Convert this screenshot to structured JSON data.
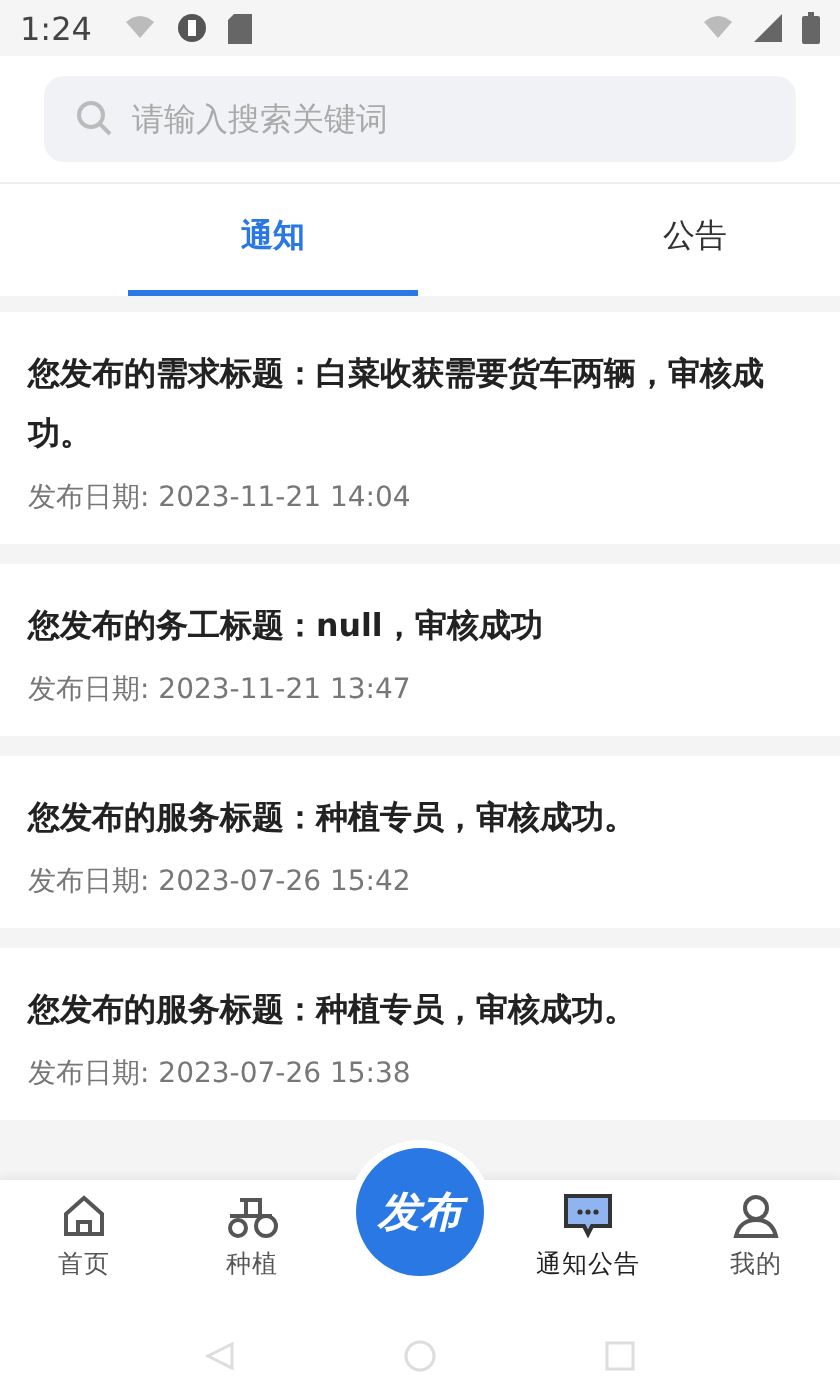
{
  "status_bar": {
    "time": "1:24"
  },
  "search": {
    "placeholder": "请输入搜索关键词"
  },
  "tabs": [
    {
      "label": "通知",
      "selected": true
    },
    {
      "label": "公告",
      "selected": false
    }
  ],
  "notices": [
    {
      "title": "您发布的需求标题：白菜收获需要货车两辆，审核成功。",
      "date": "发布日期: 2023-11-21 14:04"
    },
    {
      "title": "您发布的务工标题：null，审核成功",
      "date": "发布日期: 2023-11-21 13:47"
    },
    {
      "title": "您发布的服务标题：种植专员，审核成功。",
      "date": "发布日期: 2023-07-26 15:42"
    },
    {
      "title": "您发布的服务标题：种植专员，审核成功。",
      "date": "发布日期: 2023-07-26 15:38"
    }
  ],
  "bottom_nav": [
    {
      "kind": "home",
      "label": "首页",
      "selected": false
    },
    {
      "kind": "tractor",
      "label": "种植",
      "selected": false
    },
    {
      "kind": "publish",
      "label": "发布",
      "selected": false
    },
    {
      "kind": "message",
      "label": "通知公告",
      "selected": true
    },
    {
      "kind": "user",
      "label": "我的",
      "selected": false
    }
  ]
}
